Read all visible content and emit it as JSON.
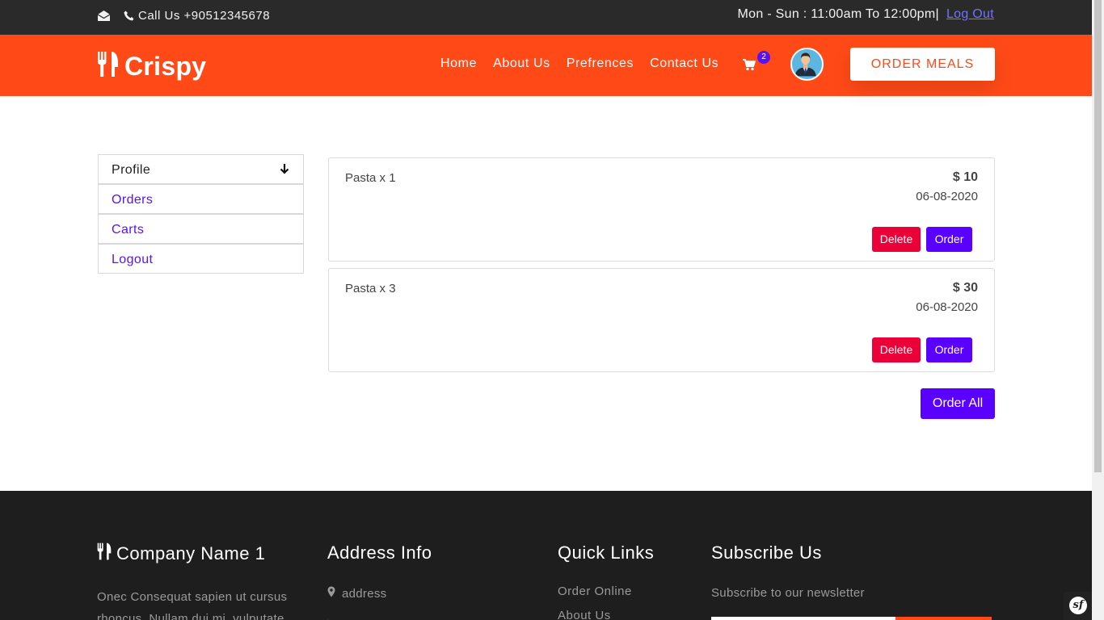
{
  "topbar": {
    "mail_icon": "envelope-open-icon",
    "phone_icon": "phone-icon",
    "call_text": "Call Us +90512345678",
    "hours": "Mon - Sun : 11:00am To 12:00pm|",
    "logout": "Log Out"
  },
  "navbar": {
    "brand_icon": "cutlery-icon",
    "brand_name": "Crispy",
    "items": [
      {
        "label": "Home"
      },
      {
        "label": "About Us"
      },
      {
        "label": "Prefrences"
      },
      {
        "label": "Contact Us"
      }
    ],
    "cart_icon": "shopping-cart-icon",
    "cart_count": "2",
    "order_button": "ORDER MEALS",
    "accent": "#ff4a17"
  },
  "sidebar": {
    "items": [
      {
        "label": "Profile"
      },
      {
        "label": "Orders"
      },
      {
        "label": "Carts"
      },
      {
        "label": "Logout"
      }
    ],
    "profile_arrow_icon": "arrow-down-icon"
  },
  "cart": {
    "items": [
      {
        "name": "Pasta x 1",
        "price": "$ 10",
        "date": "06-08-2020",
        "delete_label": "Delete",
        "order_label": "Order"
      },
      {
        "name": "Pasta x 3",
        "price": "$ 30",
        "date": "06-08-2020",
        "delete_label": "Delete",
        "order_label": "Order"
      }
    ],
    "order_all_label": "Order All"
  },
  "footer": {
    "company_title": "Company Name 1",
    "company_desc": "Onec Consequat sapien ut cursus rhoncus. Nullam dui mi, vulputate",
    "address_title": "Address Info",
    "address_text": "address",
    "quick_links_title": "Quick Links",
    "quick_links": [
      "Order Online",
      "About Us"
    ],
    "subscribe_title": "Subscribe Us",
    "subscribe_text": "Subscribe to our newsletter"
  },
  "dev_toolbar": {
    "logo": "sf"
  }
}
